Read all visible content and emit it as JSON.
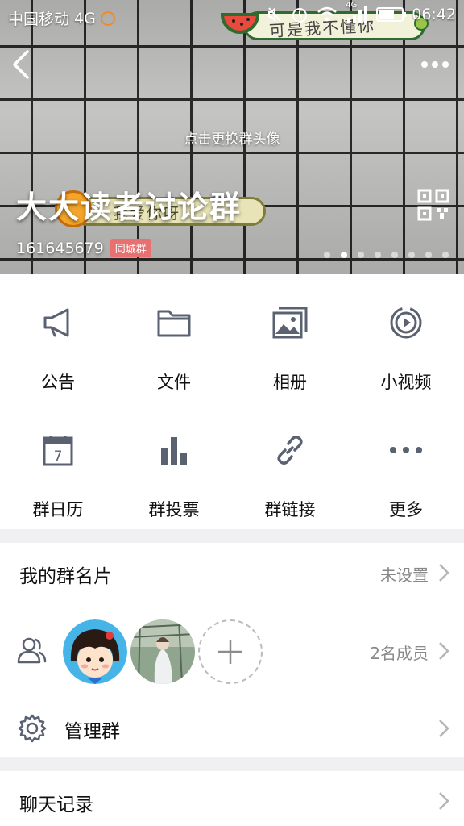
{
  "status_bar": {
    "carrier": "中国移动",
    "network": "4G",
    "signal_badge": "4G",
    "time": "06:42"
  },
  "cover": {
    "change_avatar_text": "点击更换群头像",
    "group_name": "大大读者讨论群",
    "group_id": "161645679",
    "city_badge": "同城群",
    "sticker_top_text": "可是我不懂你",
    "sticker_bottom_text": "我爱你呀",
    "page_dot_count": 8,
    "active_page_dot": 1
  },
  "features": [
    {
      "label": "公告",
      "icon": "megaphone-icon"
    },
    {
      "label": "文件",
      "icon": "folder-icon"
    },
    {
      "label": "相册",
      "icon": "album-icon"
    },
    {
      "label": "小视频",
      "icon": "video-icon"
    },
    {
      "label": "群日历",
      "icon": "calendar-icon",
      "calendar_day": "7"
    },
    {
      "label": "群投票",
      "icon": "vote-chart-icon"
    },
    {
      "label": "群链接",
      "icon": "link-icon"
    },
    {
      "label": "更多",
      "icon": "more-dots-icon"
    }
  ],
  "card": {
    "title": "我的群名片",
    "value": "未设置"
  },
  "members": {
    "count_text": "2名成员"
  },
  "manage": {
    "title": "管理群"
  },
  "chat_history": {
    "title": "聊天记录"
  },
  "colors": {
    "icon_gray": "#5a6170",
    "city_badge": "#e87070",
    "secondary_text": "#888888"
  }
}
